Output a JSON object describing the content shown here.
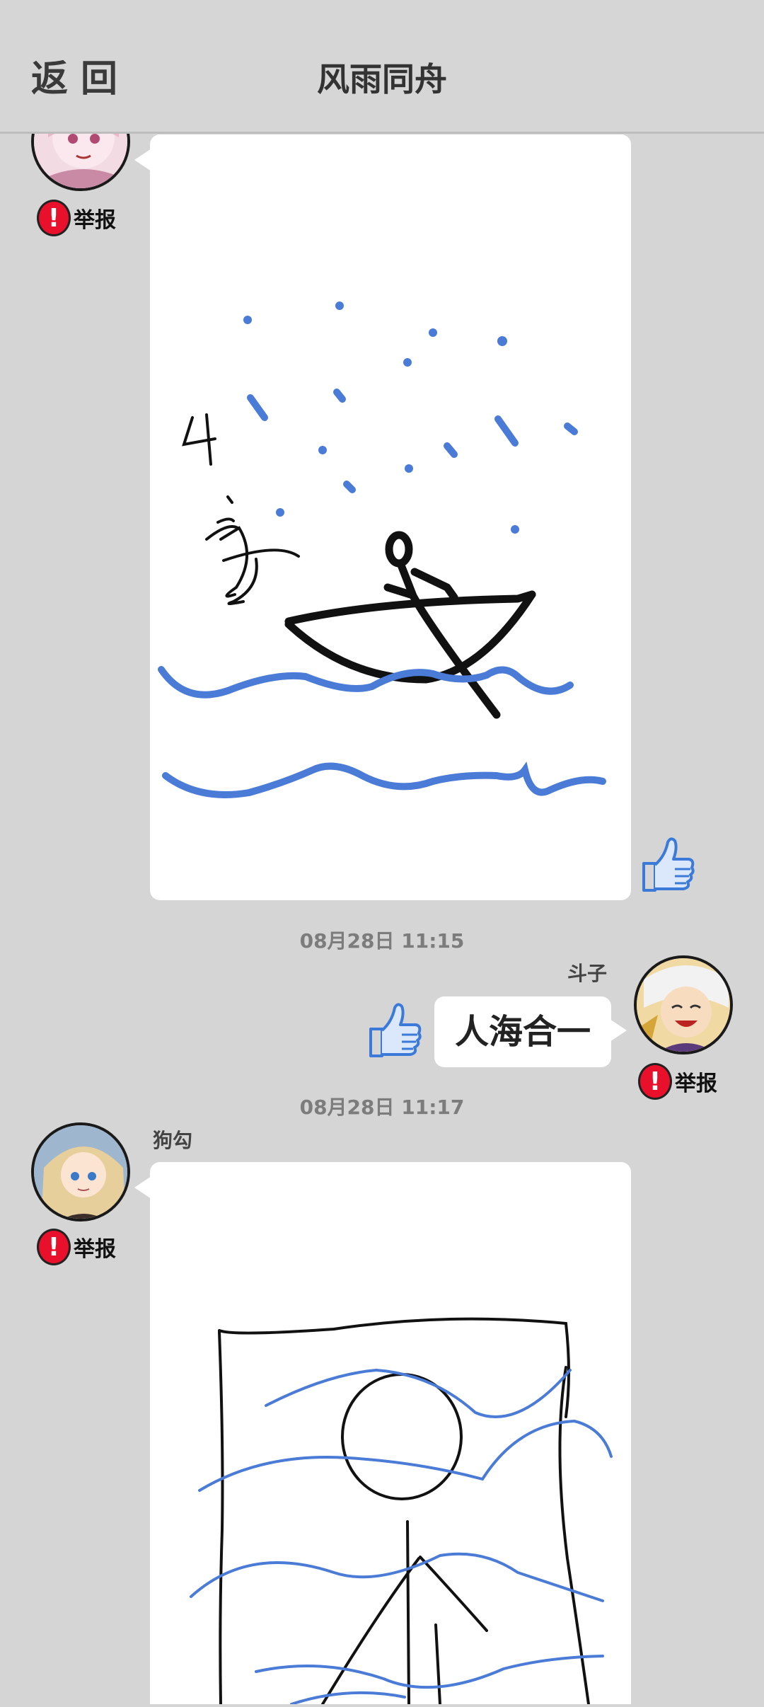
{
  "header": {
    "back_label": "返回",
    "title": "风雨同舟"
  },
  "colors": {
    "background": "#d5d5d5",
    "bubble": "#ffffff",
    "report_red": "#e8102a",
    "thumb_blue": "#3b7ad9",
    "drawing_blue": "#4a7bd6"
  },
  "messages": [
    {
      "type": "drawing",
      "side": "left",
      "report_label": "举报",
      "drawing_text": "4字"
    },
    {
      "type": "text",
      "side": "right",
      "timestamp": "08月28日  11:15",
      "sender": "斗子",
      "text": "人海合一",
      "report_label": "举报"
    },
    {
      "type": "drawing",
      "side": "left",
      "timestamp": "08月28日  11:17",
      "sender": "狗勾",
      "report_label": "举报"
    }
  ],
  "icons": {
    "like": "thumbs-up-icon",
    "report": "exclamation-icon"
  }
}
